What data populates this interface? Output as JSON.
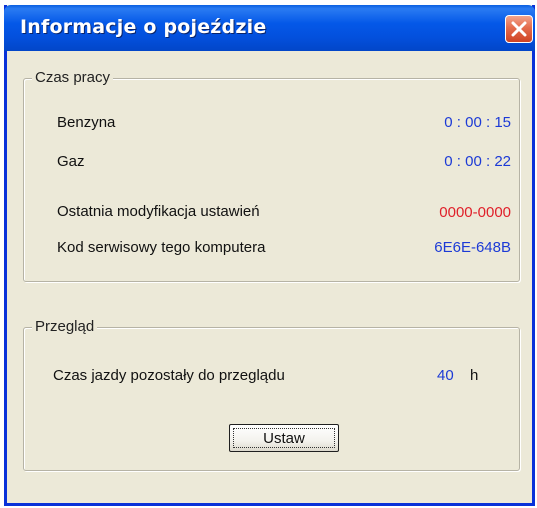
{
  "window": {
    "title": "Informacje o pojeździe"
  },
  "colors": {
    "title_bar": "#0458e8",
    "value_blue": "#1c3ad6",
    "value_red": "#e0202a",
    "dialog_bg": "#ece9d8"
  },
  "icons": {
    "close": "close-icon"
  },
  "czas_pracy": {
    "title": "Czas pracy",
    "rows": [
      {
        "label": "Benzyna",
        "value": "0 : 00 : 15"
      },
      {
        "label": "Gaz",
        "value": "0 : 00 : 22"
      },
      {
        "label": "Ostatnia modyfikacja ustawień",
        "value": "0000-0000"
      },
      {
        "label": "Kod serwisowy tego komputera",
        "value": "6E6E-648B"
      }
    ]
  },
  "przeglad": {
    "title": "Przegląd",
    "label": "Czas jazdy pozostały do przeglądu",
    "value": "40",
    "unit": "h",
    "button_label": "Ustaw"
  }
}
